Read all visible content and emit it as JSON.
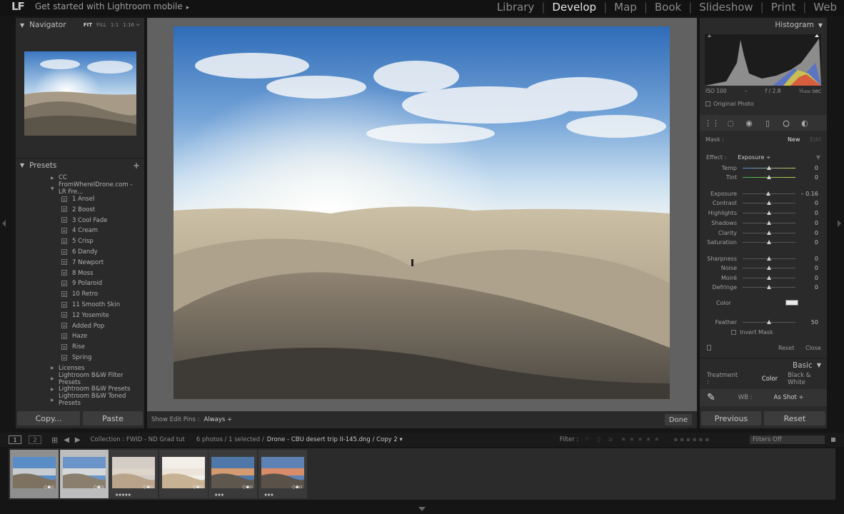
{
  "topbar": {
    "logo": "LF",
    "get_started": "Get started with Lightroom mobile",
    "get_started_arrow": "▸",
    "modules": [
      "Library",
      "Develop",
      "Map",
      "Book",
      "Slideshow",
      "Print",
      "Web"
    ],
    "active_module": "Develop"
  },
  "navigator": {
    "title": "Navigator",
    "options": [
      "FIT",
      "FILL",
      "1:1",
      "1:16 ÷"
    ]
  },
  "presets": {
    "title": "Presets",
    "add": "+",
    "items": [
      {
        "label": "CC",
        "level": "top",
        "state": "collapsed"
      },
      {
        "label": "FromWhereIDrone.com - LR Fre...",
        "level": "top",
        "state": "expanded"
      },
      {
        "label": "1 Ansel",
        "level": "sub"
      },
      {
        "label": "2 Boost",
        "level": "sub"
      },
      {
        "label": "3 Cool Fade",
        "level": "sub"
      },
      {
        "label": "4 Cream",
        "level": "sub"
      },
      {
        "label": "5 Crisp",
        "level": "sub"
      },
      {
        "label": "6 Dandy",
        "level": "sub"
      },
      {
        "label": "7 Newport",
        "level": "sub"
      },
      {
        "label": "8 Moss",
        "level": "sub"
      },
      {
        "label": "9 Polaroid",
        "level": "sub"
      },
      {
        "label": "10 Retro",
        "level": "sub"
      },
      {
        "label": "11 Smooth Skin",
        "level": "sub"
      },
      {
        "label": "12 Yosemite",
        "level": "sub"
      },
      {
        "label": "Added Pop",
        "level": "sub"
      },
      {
        "label": "Haze",
        "level": "sub"
      },
      {
        "label": "Rise",
        "level": "sub"
      },
      {
        "label": "Spring",
        "level": "sub"
      },
      {
        "label": "Licenses",
        "level": "top",
        "state": "collapsed"
      },
      {
        "label": "Lightroom B&W Filter Presets",
        "level": "top",
        "state": "collapsed"
      },
      {
        "label": "Lightroom B&W Presets",
        "level": "top",
        "state": "collapsed"
      },
      {
        "label": "Lightroom B&W Toned Presets",
        "level": "top",
        "state": "collapsed"
      }
    ]
  },
  "left_buttons": {
    "copy": "Copy...",
    "paste": "Paste"
  },
  "toolbar": {
    "show_edit_pins": "Show Edit Pins :",
    "pins_value": "Always ÷",
    "done": "Done"
  },
  "histogram": {
    "title": "Histogram",
    "iso": "ISO 100",
    "focal": "–",
    "aperture": "f / 2.8",
    "shutter": "¹⁄₁₆₀₀ sec",
    "original_photo": "Original Photo"
  },
  "mask": {
    "label": "Mask :",
    "new": "New",
    "edit": "Edit"
  },
  "effect": {
    "label": "Effect :",
    "value": "Exposure ÷"
  },
  "sliders": [
    {
      "label": "Temp",
      "value": "0",
      "pos": 0.5,
      "color": "#4f88d8"
    },
    {
      "label": "Tint",
      "value": "0",
      "pos": 0.5,
      "color": "#3fb04f"
    },
    {
      "label": "Exposure",
      "value": "– 0.16",
      "pos": 0.48
    },
    {
      "label": "Contrast",
      "value": "0",
      "pos": 0.5
    },
    {
      "label": "Highlights",
      "value": "0",
      "pos": 0.5
    },
    {
      "label": "Shadows",
      "value": "0",
      "pos": 0.5
    },
    {
      "label": "Clarity",
      "value": "0",
      "pos": 0.5
    },
    {
      "label": "Saturation",
      "value": "0",
      "pos": 0.5
    },
    {
      "label": "Sharpness",
      "value": "0",
      "pos": 0.5
    },
    {
      "label": "Noise",
      "value": "0",
      "pos": 0.5
    },
    {
      "label": "Moiré",
      "value": "0",
      "pos": 0.5
    },
    {
      "label": "Defringe",
      "value": "0",
      "pos": 0.5
    },
    {
      "label": "Feather",
      "value": "50",
      "pos": 0.5
    }
  ],
  "color_label": "Color",
  "invert_mask": "Invert Mask",
  "reset_close": {
    "reset": "Reset",
    "close": "Close"
  },
  "basic": {
    "title": "Basic",
    "treatment_label": "Treatment :",
    "color": "Color",
    "bw": "Black & White",
    "wb_label": "WB :",
    "wb_value": "As Shot ÷"
  },
  "right_buttons": {
    "previous": "Previous",
    "reset": "Reset"
  },
  "filmstrip_bar": {
    "page1": "1",
    "page2": "2",
    "collection": "Collection : FWID - ND Grad tut",
    "count": "6 photos / 1 selected /",
    "filename": "Drone - CBU desert trip II-145.dng / Copy 2 ▾",
    "filter_label": "Filter :",
    "filter_value": "Filters Off"
  },
  "thumbnails": [
    {
      "stars": "",
      "selected": "sel2"
    },
    {
      "stars": "",
      "selected": "sel"
    },
    {
      "stars": "★★★★★",
      "selected": ""
    },
    {
      "stars": "",
      "selected": ""
    },
    {
      "stars": "★★★",
      "selected": ""
    },
    {
      "stars": "★★★",
      "selected": ""
    }
  ],
  "colors": {
    "accent": "#e6e6e6",
    "panel": "#2a2a2a",
    "background": "#151515"
  }
}
